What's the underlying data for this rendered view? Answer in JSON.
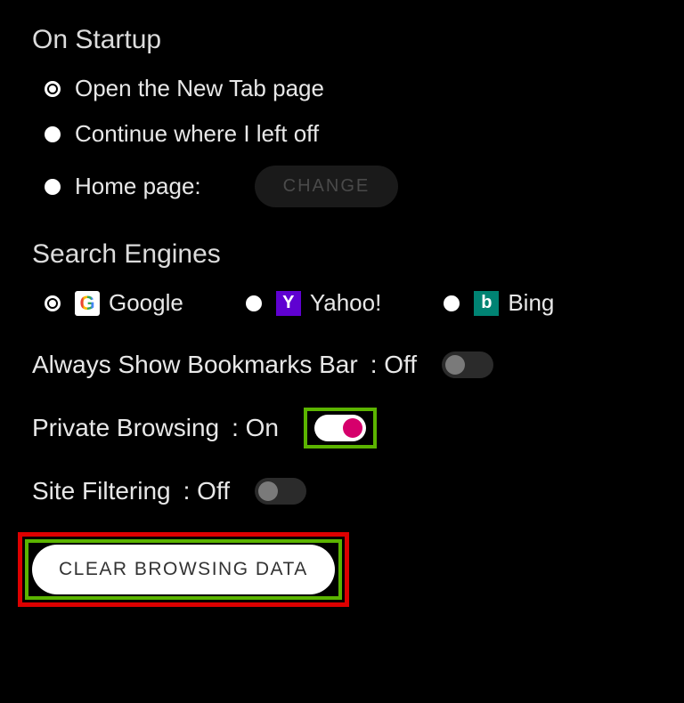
{
  "startup": {
    "title": "On Startup",
    "options": [
      {
        "label": "Open the New Tab page",
        "selected": true
      },
      {
        "label": "Continue where I left off",
        "selected": false
      },
      {
        "label": "Home page:",
        "selected": false
      }
    ],
    "change_button": "CHANGE"
  },
  "search_engines": {
    "title": "Search Engines",
    "options": [
      {
        "label": "Google",
        "selected": true,
        "icon": "google"
      },
      {
        "label": "Yahoo!",
        "selected": false,
        "icon": "yahoo"
      },
      {
        "label": "Bing",
        "selected": false,
        "icon": "bing"
      }
    ]
  },
  "toggles": {
    "bookmarks": {
      "label": "Always Show Bookmarks Bar",
      "state_text": ": Off",
      "on": false
    },
    "private_browsing": {
      "label": "Private Browsing",
      "state_text": ": On",
      "on": true,
      "highlighted": true
    },
    "site_filtering": {
      "label": "Site Filtering",
      "state_text": ": Off",
      "on": false
    }
  },
  "clear_button": {
    "label": "CLEAR BROWSING DATA",
    "highlighted": true
  }
}
